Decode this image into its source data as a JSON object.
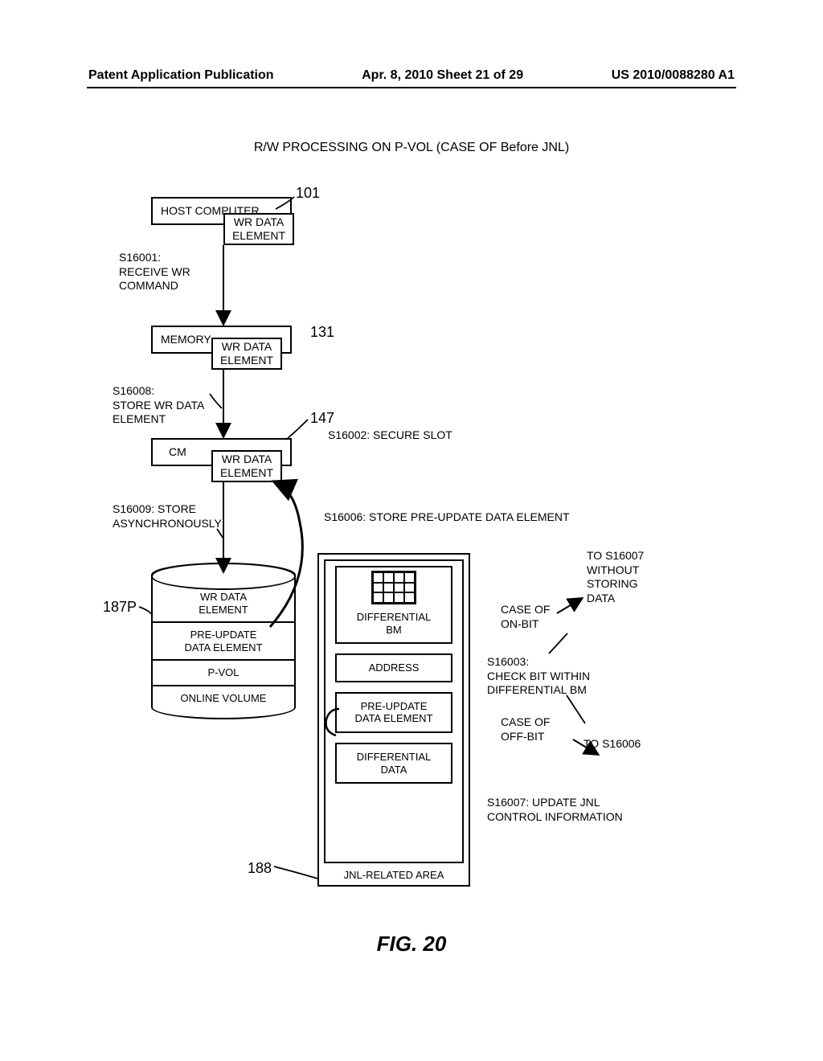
{
  "header": {
    "left": "Patent Application Publication",
    "center": "Apr. 8, 2010  Sheet 21 of 29",
    "right": "US 2010/0088280 A1"
  },
  "title": "R/W PROCESSING ON P-VOL (CASE OF Before JNL)",
  "refs": {
    "r101": "101",
    "r131": "131",
    "r147": "147",
    "r187P": "187P",
    "r188": "188"
  },
  "boxes": {
    "host": "HOST COMPUTER",
    "wr_host": "WR DATA\nELEMENT",
    "memory": "MEMORY",
    "wr_mem": "WR DATA\nELEMENT",
    "cm": "CM",
    "wr_cm": "WR DATA\nELEMENT"
  },
  "cylinder": {
    "wr": "WR DATA\nELEMENT",
    "preupd": "PRE-UPDATE\nDATA ELEMENT",
    "pvol": "P-VOL",
    "online": "ONLINE VOLUME"
  },
  "jnl": {
    "diff_bm": "DIFFERENTIAL\nBM",
    "address": "ADDRESS",
    "preupd": "PRE-UPDATE\nDATA ELEMENT",
    "diff_data": "DIFFERENTIAL\nDATA",
    "area": "JNL-RELATED AREA"
  },
  "steps": {
    "s16001": "S16001:\nRECEIVE WR\nCOMMAND",
    "s16002": "S16002: SECURE SLOT",
    "s16003": "S16003:\nCHECK BIT WITHIN\nDIFFERENTIAL BM",
    "s16006": "S16006: STORE PRE-UPDATE DATA ELEMENT",
    "s16007": "S16007: UPDATE JNL\nCONTROL INFORMATION",
    "s16008": "S16008:\nSTORE WR DATA\nELEMENT",
    "s16009": "S16009: STORE\nASYNCHRONOUSLY",
    "onbit": "CASE OF\nON-BIT",
    "offbit": "CASE OF\nOFF-BIT",
    "to_s16007": "TO S16007\nWITHOUT\nSTORING\nDATA",
    "to_s16006": "TO S16006"
  },
  "figure": "FIG. 20"
}
